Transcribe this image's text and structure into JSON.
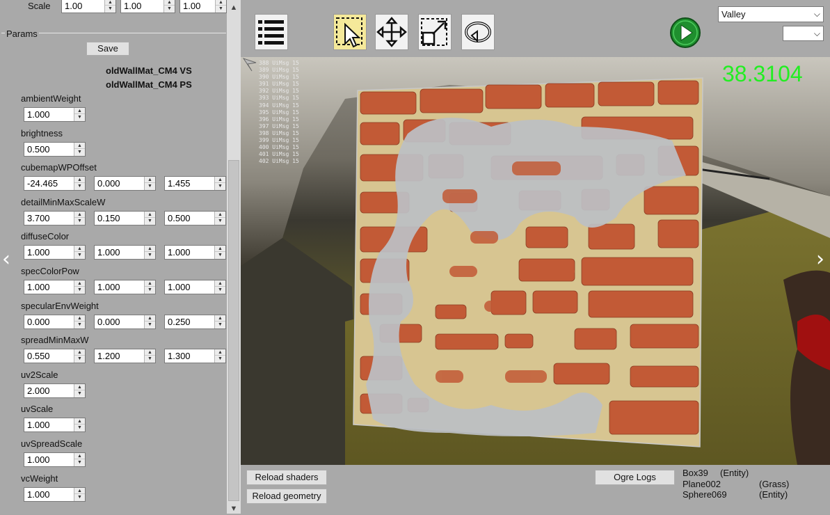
{
  "top_row": {
    "label": "Scale",
    "values": [
      "1.00",
      "1.00",
      "1.00"
    ]
  },
  "params": {
    "group_title": "Params",
    "save_label": "Save",
    "shader_vs": "oldWallMat_CM4 VS",
    "shader_ps": "oldWallMat_CM4 PS",
    "items": [
      {
        "name": "ambientWeight",
        "values": [
          "1.000"
        ]
      },
      {
        "name": "brightness",
        "values": [
          "0.500"
        ]
      },
      {
        "name": "cubemapWPOffset",
        "values": [
          "-24.465",
          "0.000",
          "1.455"
        ]
      },
      {
        "name": "detailMinMaxScaleW",
        "values": [
          "3.700",
          "0.150",
          "0.500"
        ]
      },
      {
        "name": "diffuseColor",
        "values": [
          "1.000",
          "1.000",
          "1.000"
        ]
      },
      {
        "name": "specColorPow",
        "values": [
          "1.000",
          "1.000",
          "1.000"
        ]
      },
      {
        "name": "specularEnvWeight",
        "values": [
          "0.000",
          "0.000",
          "0.250"
        ]
      },
      {
        "name": "spreadMinMaxW",
        "values": [
          "0.550",
          "1.200",
          "1.300"
        ]
      },
      {
        "name": "uv2Scale",
        "values": [
          "2.000"
        ]
      },
      {
        "name": "uvScale",
        "values": [
          "1.000"
        ]
      },
      {
        "name": "uvSpreadScale",
        "values": [
          "1.000"
        ]
      },
      {
        "name": "vcWeight",
        "values": [
          "1.000"
        ]
      }
    ]
  },
  "toolbar": {
    "tools": [
      "list-icon",
      "select-icon",
      "move-icon",
      "scale-icon",
      "rotate-icon"
    ],
    "play_icon": "play-icon",
    "scene_select": "Valley",
    "scene_options": [
      "Valley"
    ],
    "second_select": ""
  },
  "viewport": {
    "fps": "38.3104",
    "fps_color": "#22ee22",
    "log_lines": [
      "388 UiMsg 15",
      "389 UiMsg 15",
      "390 UiMsg 15",
      "391 UiMsg 15",
      "392 UiMsg 15",
      "393 UiMsg 15",
      "394 UiMsg 15",
      "395 UiMsg 15",
      "396 UiMsg 15",
      "397 UiMsg 15",
      "398 UiMsg 15",
      "399 UiMsg 15",
      "400 UiMsg 15",
      "401 UiMsg 15",
      "402 UiMsg 15"
    ]
  },
  "bottom": {
    "reload_shaders": "Reload shaders",
    "reload_geometry": "Reload geometry",
    "ogre_logs": "Ogre Logs",
    "entities": [
      {
        "name": "Box39",
        "type": "(Entity)"
      },
      {
        "name": "Plane002",
        "type": "(Grass)"
      },
      {
        "name": "Sphere069",
        "type": "(Entity)"
      }
    ]
  },
  "colors": {
    "panel": "#a9a9a9",
    "brick": "#c8603a",
    "mortar": "#d8c79a",
    "plaster": "#b8bcc2"
  }
}
